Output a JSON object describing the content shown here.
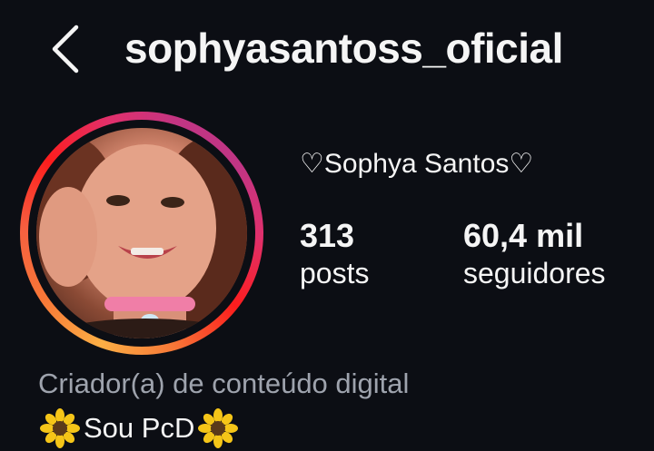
{
  "header": {
    "username": "sophyasantoss_oficial",
    "back_icon": "chevron-left-icon"
  },
  "profile": {
    "display_name": "♡Sophya Santos♡",
    "stats": [
      {
        "value": "313",
        "label": "posts"
      },
      {
        "value": "60,4 mil",
        "label": "seguidores"
      }
    ],
    "category": "Criador(a) de conteúdo digital",
    "bio": "Sou PcD",
    "bio_emoji": "sunflower-icon",
    "story_ring_colors": [
      "#fcaf45",
      "#f77737",
      "#fd1d1d",
      "#e1306c",
      "#c13584"
    ]
  }
}
